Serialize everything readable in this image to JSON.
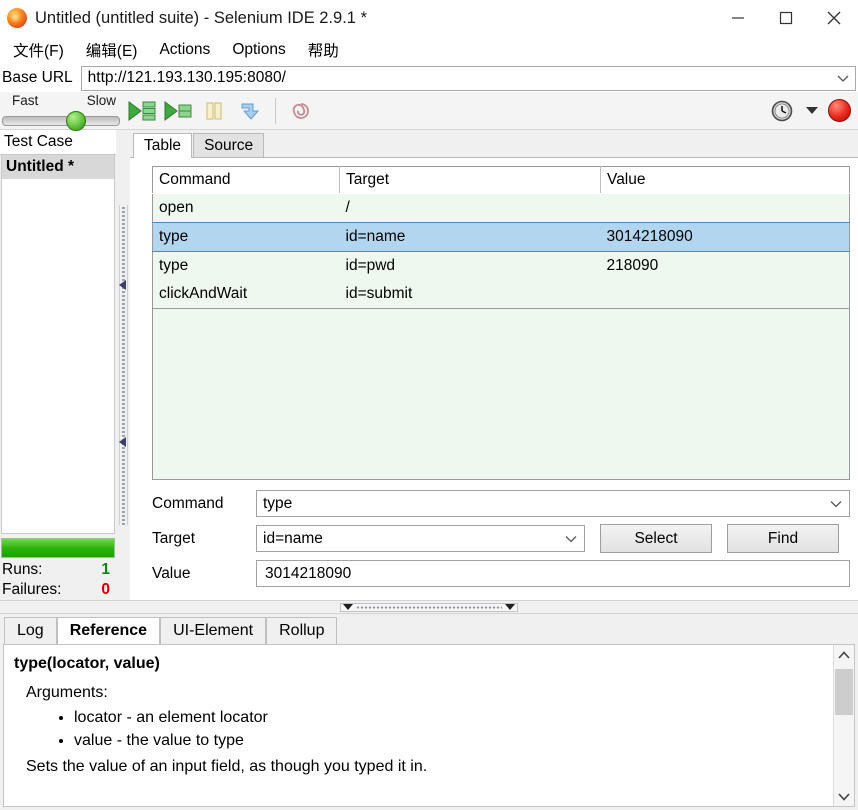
{
  "window": {
    "title": "Untitled (untitled suite) - Selenium IDE 2.9.1 *",
    "app_icon": "firefox-icon",
    "minimize_label": "—",
    "maximize_label": "□",
    "close_label": "✕"
  },
  "menu": {
    "items": [
      {
        "label": "文件(F)",
        "name": "menu-file"
      },
      {
        "label": "编辑(E)",
        "name": "menu-edit"
      },
      {
        "label": "Actions",
        "name": "menu-actions"
      },
      {
        "label": "Options",
        "name": "menu-options"
      },
      {
        "label": "帮助",
        "name": "menu-help"
      }
    ]
  },
  "baseurl": {
    "label": "Base URL",
    "value": "http://121.193.130.195:8080/"
  },
  "toolbar": {
    "speed_fast_label": "Fast",
    "speed_slow_label": "Slow",
    "buttons": [
      {
        "name": "play-entire-suite-button",
        "icon": "play-all-icon"
      },
      {
        "name": "play-current-test-case-button",
        "icon": "play-current-icon"
      },
      {
        "name": "pause-button",
        "icon": "pause-icon"
      },
      {
        "name": "step-button",
        "icon": "step-icon"
      },
      {
        "name": "rollup-button",
        "icon": "spiral-icon"
      }
    ],
    "schedule_icon": "clock-icon",
    "schedule_dropdown_icon": "chevron-down-icon",
    "record_icon": "record-dot-icon"
  },
  "testcase_pane": {
    "header": "Test Case",
    "items": [
      {
        "label": "Untitled *",
        "selected": true
      }
    ],
    "progress_percent": 100,
    "runs_label": "Runs:",
    "runs_value": "1",
    "failures_label": "Failures:",
    "failures_value": "0",
    "runs_color": "#0a8a0a",
    "failures_color": "#cc0000"
  },
  "editor": {
    "tabs": [
      {
        "label": "Table",
        "active": true
      },
      {
        "label": "Source",
        "active": false
      }
    ],
    "table": {
      "columns": [
        "Command",
        "Target",
        "Value"
      ],
      "rows": [
        {
          "command": "open",
          "target": "/",
          "value": "",
          "selected": false
        },
        {
          "command": "type",
          "target": "id=name",
          "value": "3014218090",
          "selected": true
        },
        {
          "command": "type",
          "target": "id=pwd",
          "value": "218090",
          "selected": false
        },
        {
          "command": "clickAndWait",
          "target": "id=submit",
          "value": "",
          "selected": false
        }
      ],
      "row_background": "#eef8ee",
      "selected_background": "#b3d6f0"
    },
    "form": {
      "command_label": "Command",
      "command_value": "type",
      "target_label": "Target",
      "target_value": "id=name",
      "select_button": "Select",
      "find_button": "Find",
      "value_label": "Value",
      "value_value": "3014218090"
    }
  },
  "bottom": {
    "tabs": [
      {
        "label": "Log",
        "active": false
      },
      {
        "label": "Reference",
        "active": true
      },
      {
        "label": "UI-Element",
        "active": false
      },
      {
        "label": "Rollup",
        "active": false
      }
    ],
    "reference": {
      "signature": "type(locator, value)",
      "arguments_label": "Arguments:",
      "arguments": [
        "locator - an element locator",
        "value - the value to type"
      ],
      "description": "Sets the value of an input field, as though you typed it in."
    }
  }
}
